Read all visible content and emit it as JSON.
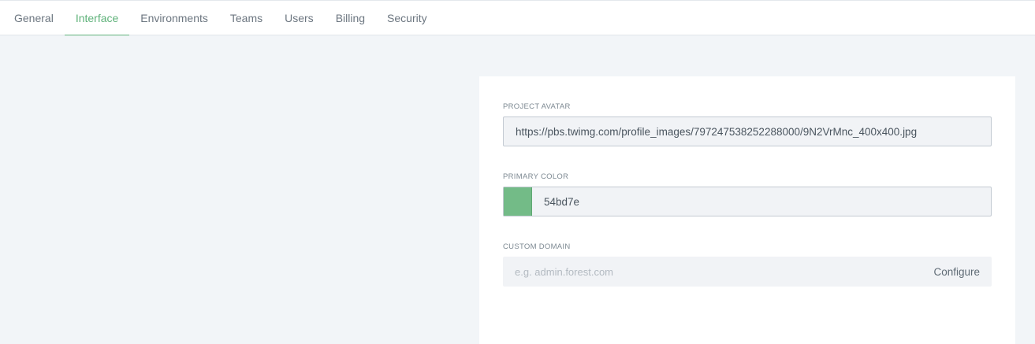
{
  "tabs": [
    {
      "label": "General"
    },
    {
      "label": "Interface",
      "active": true
    },
    {
      "label": "Environments"
    },
    {
      "label": "Teams"
    },
    {
      "label": "Users"
    },
    {
      "label": "Billing"
    },
    {
      "label": "Security"
    }
  ],
  "form": {
    "avatar": {
      "label": "PROJECT AVATAR",
      "value": "https://pbs.twimg.com/profile_images/797247538252288000/9N2VrMnc_400x400.jpg"
    },
    "primary_color": {
      "label": "PRIMARY COLOR",
      "value": "54bd7e",
      "swatch_color": "#73bb87"
    },
    "custom_domain": {
      "label": "CUSTOM DOMAIN",
      "placeholder": "e.g. admin.forest.com",
      "action_label": "Configure"
    }
  },
  "colors": {
    "accent": "#5fb27a",
    "background": "#f2f5f8"
  }
}
